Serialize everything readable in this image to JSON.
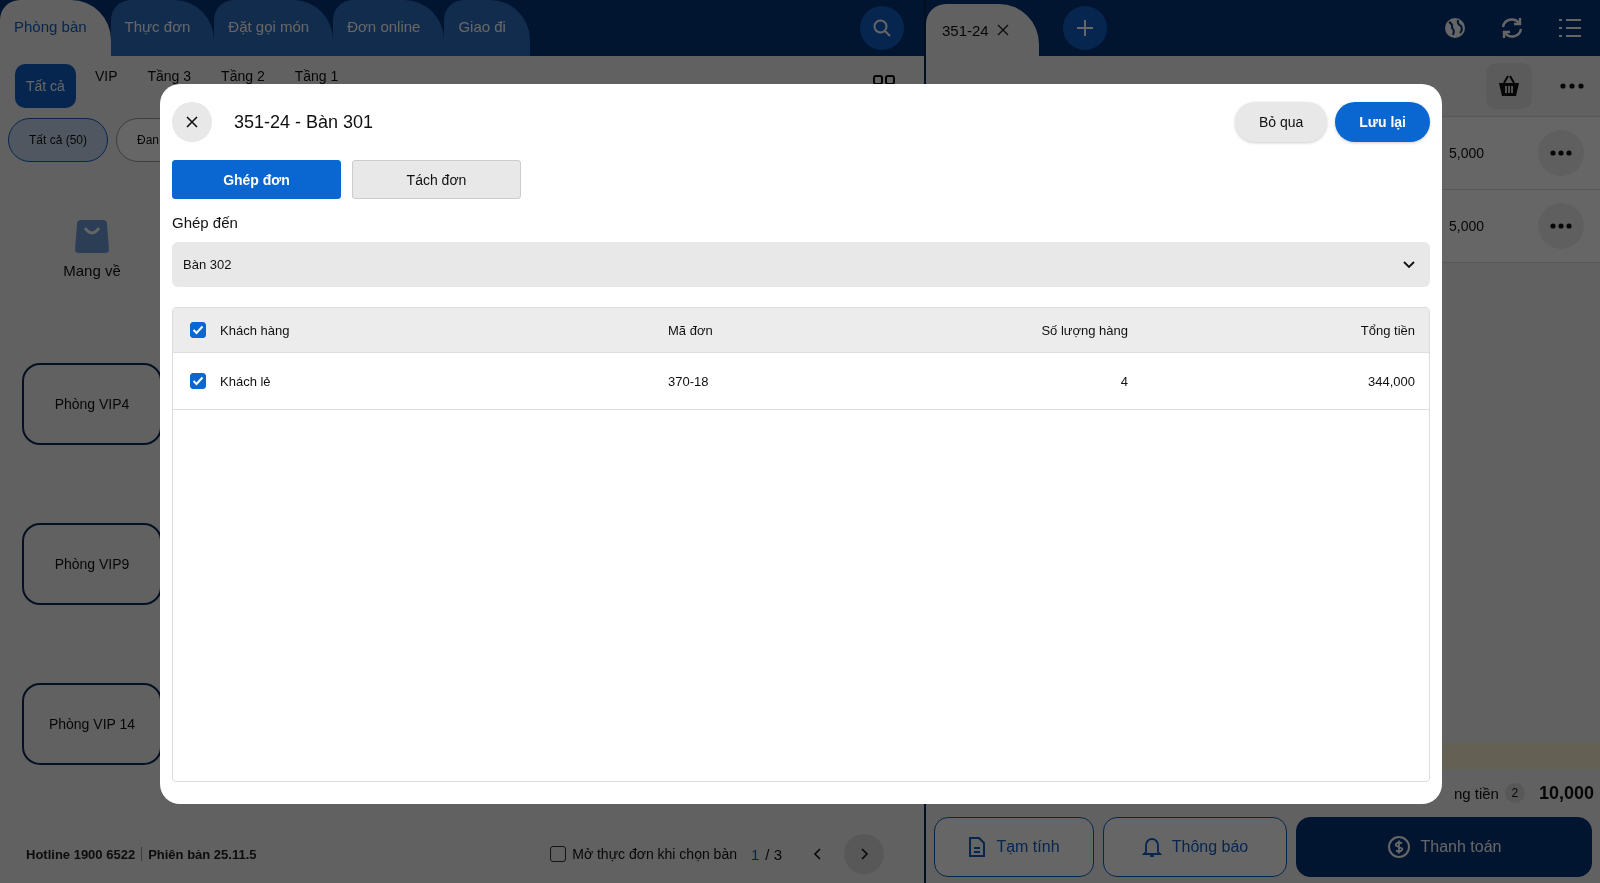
{
  "left_panel": {
    "tabs": [
      {
        "label": "Phòng bàn",
        "selected": true
      },
      {
        "label": "Thực đơn",
        "selected": false
      },
      {
        "label": "Đặt gọi món",
        "selected": false
      },
      {
        "label": "Đơn online",
        "selected": false
      },
      {
        "label": "Giao đi",
        "selected": false
      }
    ],
    "area_tabs": [
      {
        "label": "Tất cả",
        "selected": true
      },
      {
        "label": "VIP",
        "selected": false
      },
      {
        "label": "Tầng 3",
        "selected": false
      },
      {
        "label": "Tầng 2",
        "selected": false
      },
      {
        "label": "Tầng 1",
        "selected": false
      }
    ],
    "filter_chips": [
      {
        "label": "Tất cả (50)",
        "selected": true
      },
      {
        "label": "Đan",
        "selected": false
      }
    ],
    "takeaway": {
      "label": "Mang về"
    },
    "tables": [
      {
        "name": "Phòng VIP4"
      },
      {
        "name": "Phòng VIP9"
      },
      {
        "name": "Phòng VIP 14"
      }
    ],
    "footer": {
      "hotline": "Hotline 1900 6522",
      "version": "Phiên bản 25.11.5",
      "open_menu_option": {
        "label": "Mở thực đơn khi chọn bàn",
        "checked": false
      },
      "page_current": "1",
      "page_total": "/ 3"
    }
  },
  "right_panel": {
    "order_tabs": [
      {
        "label": "351-24"
      }
    ],
    "items": [
      {
        "price": "5,000"
      },
      {
        "price": "5,000"
      }
    ],
    "total": {
      "label": "ng tiền",
      "count": "2",
      "amount": "10,000"
    },
    "actions": [
      {
        "label": "Tạm tính",
        "kind": "draft"
      },
      {
        "label": "Thông báo",
        "kind": "notify"
      },
      {
        "label": "Thanh toán",
        "kind": "pay"
      }
    ]
  },
  "dialog": {
    "title": "351-24 - Bàn 301",
    "buttons": [
      {
        "label": "Bỏ qua",
        "kind": "secondary"
      },
      {
        "label": "Lưu lại",
        "kind": "primary"
      }
    ],
    "modes": [
      {
        "label": "Ghép đơn",
        "selected": true
      },
      {
        "label": "Tách đơn",
        "selected": false
      }
    ],
    "target_label": "Ghép đến",
    "target_value": "Bàn 302",
    "table": {
      "all_checked": true,
      "columns": [
        "Khách hàng",
        "Mã đơn",
        "Số lượng hàng",
        "Tổng tiền"
      ],
      "rows": [
        {
          "checked": true,
          "cells": [
            "Khách lẻ",
            "370-18",
            "4",
            "344,000"
          ]
        }
      ]
    }
  }
}
